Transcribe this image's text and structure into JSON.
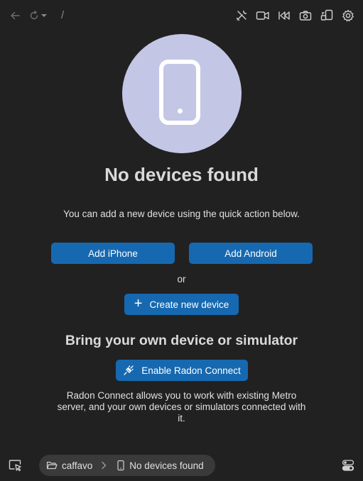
{
  "toolbar": {
    "icons": [
      "back-arrow-icon",
      "reload-icon",
      "dropdown-caret-icon",
      "tools-icon",
      "record-video-icon",
      "replay-icon",
      "screenshot-camera-icon",
      "device-settings-icon",
      "gear-icon"
    ],
    "path_separator": "/"
  },
  "hero": {
    "icon": "smartphone-icon",
    "circle_color": "#c4c6e6"
  },
  "main": {
    "title": "No devices found",
    "subtitle": "You can add a new device using the quick action below.",
    "add_iphone_label": "Add iPhone",
    "add_android_label": "Add Android",
    "or_label": "or",
    "create_device_label": "Create new device",
    "byod_title": "Bring your own device or simulator",
    "enable_radon_label": "Enable Radon Connect",
    "radon_description": "Radon Connect allows you to work with existing Metro server, and your own devices or simulators connected with it."
  },
  "bottom_bar": {
    "project_name": "caffavo",
    "device_label": "No devices found"
  },
  "colors": {
    "background": "#212121",
    "button": "#1669b0",
    "breadcrumb_bg": "#3a3a3a"
  }
}
